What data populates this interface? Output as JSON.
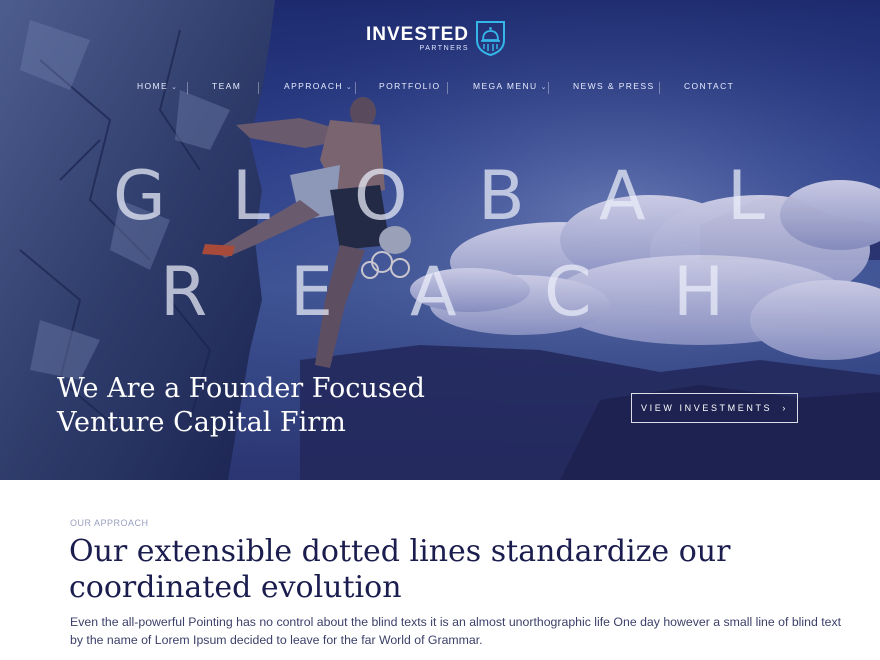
{
  "logo": {
    "name": "INVESTED",
    "subtitle": "PARTNERS"
  },
  "nav": {
    "items": [
      {
        "label": "HOME",
        "dropdown": true
      },
      {
        "label": "TEAM",
        "dropdown": false
      },
      {
        "label": "APPROACH",
        "dropdown": true
      },
      {
        "label": "PORTFOLIO",
        "dropdown": false
      },
      {
        "label": "MEGA MENU",
        "dropdown": true
      },
      {
        "label": "NEWS & PRESS",
        "dropdown": false
      },
      {
        "label": "CONTACT",
        "dropdown": false
      }
    ]
  },
  "hero": {
    "big_line1": [
      "G",
      "L",
      "O",
      "B",
      "A",
      "L"
    ],
    "big_line2": [
      "R",
      "E",
      "A",
      "C",
      "H"
    ],
    "headline_line1": "We Are a Founder Focused",
    "headline_line2": "Venture Capital Firm",
    "cta_label": "VIEW INVESTMENTS  ›"
  },
  "approach": {
    "eyebrow": "OUR APPROACH",
    "heading_line1": "Our extensible dotted lines standardize our",
    "heading_line2": "coordinated evolution",
    "body_line1": "Even the all-powerful Pointing has no control about the blind texts it is an almost unorthographic life One day however a small line of blind text",
    "body_line2": "by the name of Lorem Ipsum decided to leave for the far World of Grammar."
  },
  "colors": {
    "hero_top": "#1d2a6e",
    "hero_mid": "#3e5494",
    "heading": "#1b1d4e",
    "eyebrow": "#9aa0bf",
    "logo_accent": "#35b6e8"
  },
  "icons": [
    "bell-shield-logo-icon",
    "chevron-down-icon",
    "chevron-right-icon"
  ]
}
